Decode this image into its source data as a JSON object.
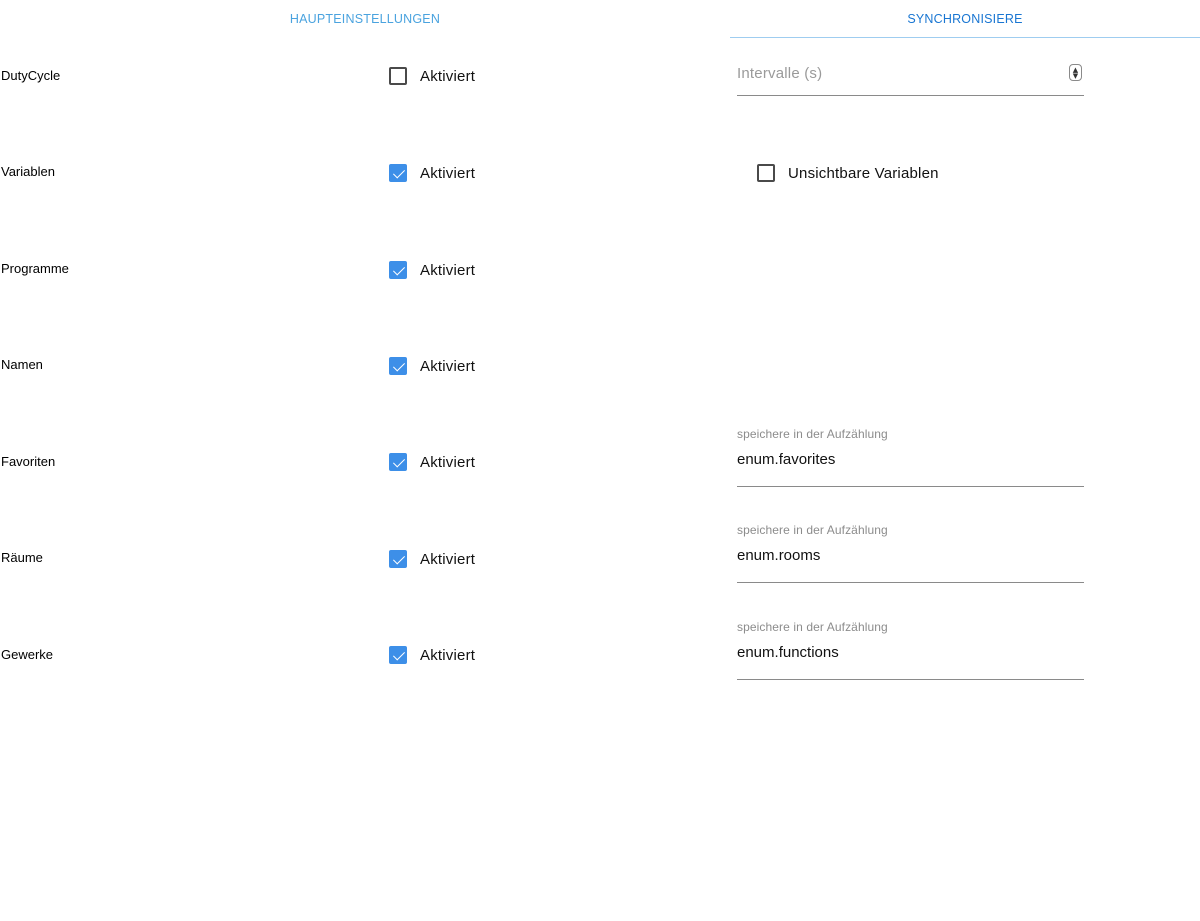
{
  "tabs": {
    "main": "HAUPTEINSTELLUNGEN",
    "sync": "SYNCHRONISIERE"
  },
  "rows": [
    {
      "label": "DutyCycle",
      "option": "Aktiviert",
      "checked": false
    },
    {
      "label": "Variablen",
      "option": "Aktiviert",
      "checked": true
    },
    {
      "label": "Programme",
      "option": "Aktiviert",
      "checked": true
    },
    {
      "label": "Namen",
      "option": "Aktiviert",
      "checked": true
    },
    {
      "label": "Favoriten",
      "option": "Aktiviert",
      "checked": true
    },
    {
      "label": "Räume",
      "option": "Aktiviert",
      "checked": true
    },
    {
      "label": "Gewerke",
      "option": "Aktiviert",
      "checked": true
    }
  ],
  "interval": {
    "placeholder": "Intervalle (s)",
    "value": ""
  },
  "invisible_variables": {
    "label": "Unsichtbare Variablen",
    "checked": false
  },
  "enum_fields": [
    {
      "caption": "speichere in der Aufzählung",
      "value": "enum.favorites"
    },
    {
      "caption": "speichere in der Aufzählung",
      "value": "enum.rooms"
    },
    {
      "caption": "speichere in der Aufzählung",
      "value": "enum.functions"
    }
  ],
  "colors": {
    "tab_main": "#4aa3df",
    "tab_active": "#1976d2",
    "checkbox_checked": "#3d8fe8"
  }
}
